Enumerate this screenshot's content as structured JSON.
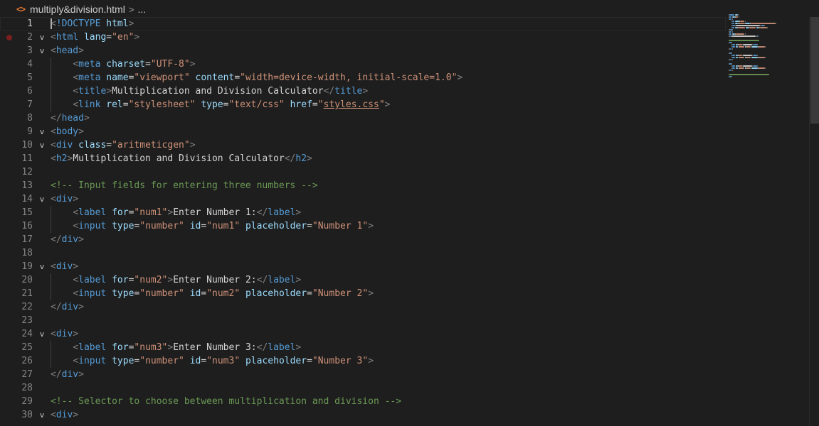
{
  "breadcrumb": {
    "file_icon": "<>",
    "file_name": "multiply&division.html",
    "separator": ">",
    "ellipsis": "..."
  },
  "colors": {
    "background": "#1e1e1e",
    "tag": "#569cd6",
    "attribute": "#9cdcfe",
    "string": "#ce9178",
    "comment": "#6a9955",
    "text": "#d4d4d4",
    "line_number": "#858585",
    "breakpoint": "#7a1e1e",
    "file_icon": "#e37933"
  },
  "editor": {
    "current_line": 1,
    "lines": [
      {
        "n": "1",
        "fold": "",
        "tokens": [
          [
            "punc",
            "<"
          ],
          [
            "tag",
            "!DOCTYPE"
          ],
          [
            "txt",
            " "
          ],
          [
            "attr",
            "html"
          ],
          [
            "punc",
            ">"
          ]
        ]
      },
      {
        "n": "2",
        "fold": "v",
        "bp": true,
        "tokens": [
          [
            "punc",
            "<"
          ],
          [
            "tag",
            "html"
          ],
          [
            "txt",
            " "
          ],
          [
            "attr",
            "lang"
          ],
          [
            "txt",
            "="
          ],
          [
            "str",
            "\"en\""
          ],
          [
            "punc",
            ">"
          ]
        ]
      },
      {
        "n": "3",
        "fold": "v",
        "tokens": [
          [
            "punc",
            "<"
          ],
          [
            "tag",
            "head"
          ],
          [
            "punc",
            ">"
          ]
        ]
      },
      {
        "n": "4",
        "fold": "",
        "tokens": [
          [
            "txt",
            "    "
          ],
          [
            "punc",
            "<"
          ],
          [
            "tag",
            "meta"
          ],
          [
            "txt",
            " "
          ],
          [
            "attr",
            "charset"
          ],
          [
            "txt",
            "="
          ],
          [
            "str",
            "\"UTF-8\""
          ],
          [
            "punc",
            ">"
          ]
        ]
      },
      {
        "n": "5",
        "fold": "",
        "tokens": [
          [
            "txt",
            "    "
          ],
          [
            "punc",
            "<"
          ],
          [
            "tag",
            "meta"
          ],
          [
            "txt",
            " "
          ],
          [
            "attr",
            "name"
          ],
          [
            "txt",
            "="
          ],
          [
            "str",
            "\"viewport\""
          ],
          [
            "txt",
            " "
          ],
          [
            "attr",
            "content"
          ],
          [
            "txt",
            "="
          ],
          [
            "str",
            "\"width=device-width, initial-scale=1.0\""
          ],
          [
            "punc",
            ">"
          ]
        ]
      },
      {
        "n": "6",
        "fold": "",
        "tokens": [
          [
            "txt",
            "    "
          ],
          [
            "punc",
            "<"
          ],
          [
            "tag",
            "title"
          ],
          [
            "punc",
            ">"
          ],
          [
            "txt",
            "Multiplication and Division Calculator"
          ],
          [
            "punc",
            "</"
          ],
          [
            "tag",
            "title"
          ],
          [
            "punc",
            ">"
          ]
        ]
      },
      {
        "n": "7",
        "fold": "",
        "tokens": [
          [
            "txt",
            "    "
          ],
          [
            "punc",
            "<"
          ],
          [
            "tag",
            "link"
          ],
          [
            "txt",
            " "
          ],
          [
            "attr",
            "rel"
          ],
          [
            "txt",
            "="
          ],
          [
            "str",
            "\"stylesheet\""
          ],
          [
            "txt",
            " "
          ],
          [
            "attr",
            "type"
          ],
          [
            "txt",
            "="
          ],
          [
            "str",
            "\"text/css\""
          ],
          [
            "txt",
            " "
          ],
          [
            "attr",
            "href"
          ],
          [
            "txt",
            "="
          ],
          [
            "str",
            "\""
          ],
          [
            "strlink",
            "styles.css"
          ],
          [
            "str",
            "\""
          ],
          [
            "punc",
            ">"
          ]
        ]
      },
      {
        "n": "8",
        "fold": "",
        "tokens": [
          [
            "punc",
            "</"
          ],
          [
            "tag",
            "head"
          ],
          [
            "punc",
            ">"
          ]
        ]
      },
      {
        "n": "9",
        "fold": "v",
        "tokens": [
          [
            "punc",
            "<"
          ],
          [
            "tag",
            "body"
          ],
          [
            "punc",
            ">"
          ]
        ]
      },
      {
        "n": "10",
        "fold": "v",
        "tokens": [
          [
            "punc",
            "<"
          ],
          [
            "tag",
            "div"
          ],
          [
            "txt",
            " "
          ],
          [
            "attr",
            "class"
          ],
          [
            "txt",
            "="
          ],
          [
            "str",
            "\"aritmeticgen\""
          ],
          [
            "punc",
            ">"
          ]
        ]
      },
      {
        "n": "11",
        "fold": "",
        "tokens": [
          [
            "punc",
            "<"
          ],
          [
            "tag",
            "h2"
          ],
          [
            "punc",
            ">"
          ],
          [
            "txt",
            "Multiplication and Division Calculator"
          ],
          [
            "punc",
            "</"
          ],
          [
            "tag",
            "h2"
          ],
          [
            "punc",
            ">"
          ]
        ]
      },
      {
        "n": "12",
        "fold": "",
        "tokens": []
      },
      {
        "n": "13",
        "fold": "",
        "tokens": [
          [
            "cmt",
            "<!-- Input fields for entering three numbers -->"
          ]
        ]
      },
      {
        "n": "14",
        "fold": "v",
        "tokens": [
          [
            "punc",
            "<"
          ],
          [
            "tag",
            "div"
          ],
          [
            "punc",
            ">"
          ]
        ]
      },
      {
        "n": "15",
        "fold": "",
        "tokens": [
          [
            "txt",
            "    "
          ],
          [
            "punc",
            "<"
          ],
          [
            "tag",
            "label"
          ],
          [
            "txt",
            " "
          ],
          [
            "attr",
            "for"
          ],
          [
            "txt",
            "="
          ],
          [
            "str",
            "\"num1\""
          ],
          [
            "punc",
            ">"
          ],
          [
            "txt",
            "Enter Number 1:"
          ],
          [
            "punc",
            "</"
          ],
          [
            "tag",
            "label"
          ],
          [
            "punc",
            ">"
          ]
        ]
      },
      {
        "n": "16",
        "fold": "",
        "tokens": [
          [
            "txt",
            "    "
          ],
          [
            "punc",
            "<"
          ],
          [
            "tag",
            "input"
          ],
          [
            "txt",
            " "
          ],
          [
            "attr",
            "type"
          ],
          [
            "txt",
            "="
          ],
          [
            "str",
            "\"number\""
          ],
          [
            "txt",
            " "
          ],
          [
            "attr",
            "id"
          ],
          [
            "txt",
            "="
          ],
          [
            "str",
            "\"num1\""
          ],
          [
            "txt",
            " "
          ],
          [
            "attr",
            "placeholder"
          ],
          [
            "txt",
            "="
          ],
          [
            "str",
            "\"Number 1\""
          ],
          [
            "punc",
            ">"
          ]
        ]
      },
      {
        "n": "17",
        "fold": "",
        "tokens": [
          [
            "punc",
            "</"
          ],
          [
            "tag",
            "div"
          ],
          [
            "punc",
            ">"
          ]
        ]
      },
      {
        "n": "18",
        "fold": "",
        "tokens": []
      },
      {
        "n": "19",
        "fold": "v",
        "tokens": [
          [
            "punc",
            "<"
          ],
          [
            "tag",
            "div"
          ],
          [
            "punc",
            ">"
          ]
        ]
      },
      {
        "n": "20",
        "fold": "",
        "tokens": [
          [
            "txt",
            "    "
          ],
          [
            "punc",
            "<"
          ],
          [
            "tag",
            "label"
          ],
          [
            "txt",
            " "
          ],
          [
            "attr",
            "for"
          ],
          [
            "txt",
            "="
          ],
          [
            "str",
            "\"num2\""
          ],
          [
            "punc",
            ">"
          ],
          [
            "txt",
            "Enter Number 2:"
          ],
          [
            "punc",
            "</"
          ],
          [
            "tag",
            "label"
          ],
          [
            "punc",
            ">"
          ]
        ]
      },
      {
        "n": "21",
        "fold": "",
        "tokens": [
          [
            "txt",
            "    "
          ],
          [
            "punc",
            "<"
          ],
          [
            "tag",
            "input"
          ],
          [
            "txt",
            " "
          ],
          [
            "attr",
            "type"
          ],
          [
            "txt",
            "="
          ],
          [
            "str",
            "\"number\""
          ],
          [
            "txt",
            " "
          ],
          [
            "attr",
            "id"
          ],
          [
            "txt",
            "="
          ],
          [
            "str",
            "\"num2\""
          ],
          [
            "txt",
            " "
          ],
          [
            "attr",
            "placeholder"
          ],
          [
            "txt",
            "="
          ],
          [
            "str",
            "\"Number 2\""
          ],
          [
            "punc",
            ">"
          ]
        ]
      },
      {
        "n": "22",
        "fold": "",
        "tokens": [
          [
            "punc",
            "</"
          ],
          [
            "tag",
            "div"
          ],
          [
            "punc",
            ">"
          ]
        ]
      },
      {
        "n": "23",
        "fold": "",
        "tokens": []
      },
      {
        "n": "24",
        "fold": "v",
        "tokens": [
          [
            "punc",
            "<"
          ],
          [
            "tag",
            "div"
          ],
          [
            "punc",
            ">"
          ]
        ]
      },
      {
        "n": "25",
        "fold": "",
        "tokens": [
          [
            "txt",
            "    "
          ],
          [
            "punc",
            "<"
          ],
          [
            "tag",
            "label"
          ],
          [
            "txt",
            " "
          ],
          [
            "attr",
            "for"
          ],
          [
            "txt",
            "="
          ],
          [
            "str",
            "\"num3\""
          ],
          [
            "punc",
            ">"
          ],
          [
            "txt",
            "Enter Number 3:"
          ],
          [
            "punc",
            "</"
          ],
          [
            "tag",
            "label"
          ],
          [
            "punc",
            ">"
          ]
        ]
      },
      {
        "n": "26",
        "fold": "",
        "tokens": [
          [
            "txt",
            "    "
          ],
          [
            "punc",
            "<"
          ],
          [
            "tag",
            "input"
          ],
          [
            "txt",
            " "
          ],
          [
            "attr",
            "type"
          ],
          [
            "txt",
            "="
          ],
          [
            "str",
            "\"number\""
          ],
          [
            "txt",
            " "
          ],
          [
            "attr",
            "id"
          ],
          [
            "txt",
            "="
          ],
          [
            "str",
            "\"num3\""
          ],
          [
            "txt",
            " "
          ],
          [
            "attr",
            "placeholder"
          ],
          [
            "txt",
            "="
          ],
          [
            "str",
            "\"Number 3\""
          ],
          [
            "punc",
            ">"
          ]
        ]
      },
      {
        "n": "27",
        "fold": "",
        "tokens": [
          [
            "punc",
            "</"
          ],
          [
            "tag",
            "div"
          ],
          [
            "punc",
            ">"
          ]
        ]
      },
      {
        "n": "28",
        "fold": "",
        "tokens": []
      },
      {
        "n": "29",
        "fold": "",
        "tokens": [
          [
            "cmt",
            "<!-- Selector to choose between multiplication and division -->"
          ]
        ]
      },
      {
        "n": "30",
        "fold": "v",
        "tokens": [
          [
            "punc",
            "<"
          ],
          [
            "tag",
            "div"
          ],
          [
            "punc",
            ">"
          ]
        ]
      }
    ]
  }
}
